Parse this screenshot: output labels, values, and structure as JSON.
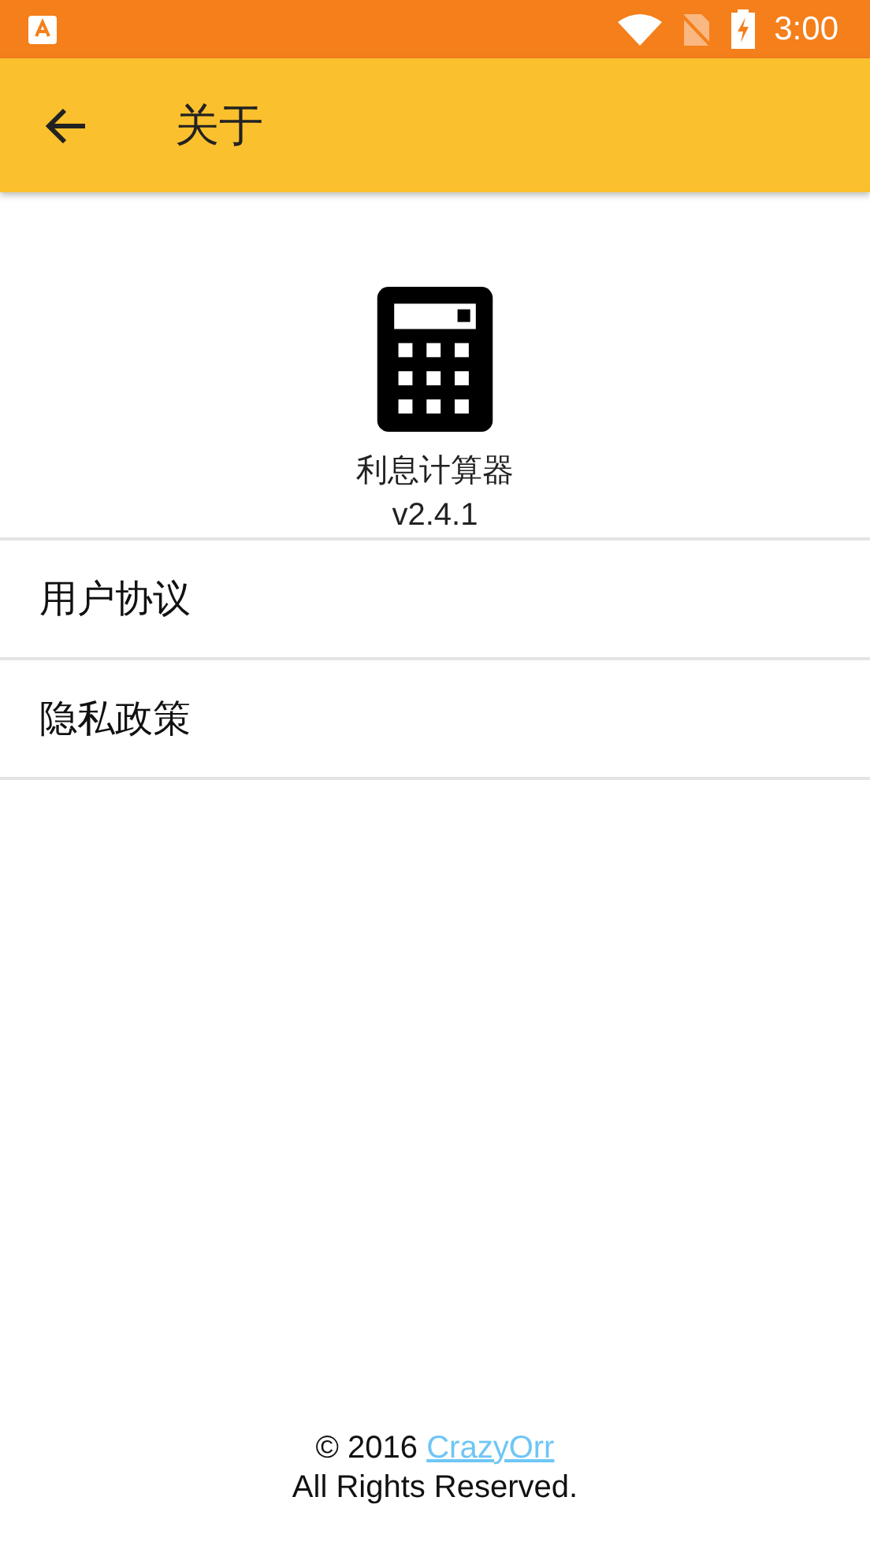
{
  "status_bar": {
    "time": "3:00"
  },
  "app_bar": {
    "title": "关于"
  },
  "app_info": {
    "name": "利息计算器",
    "version": "v2.4.1"
  },
  "menu_items": [
    {
      "label": "用户协议"
    },
    {
      "label": "隐私政策"
    }
  ],
  "footer": {
    "copyright": "© 2016 ",
    "author_link": "CrazyOrr",
    "rights": "All Rights Reserved."
  }
}
